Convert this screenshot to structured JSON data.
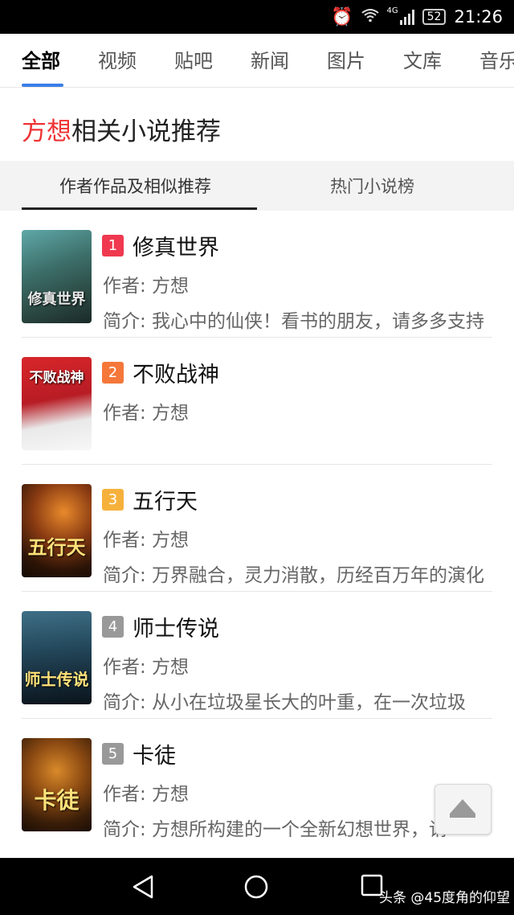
{
  "status_bar": {
    "signal_label": "4G",
    "battery": "52",
    "time": "21:26"
  },
  "nav_tabs": [
    {
      "label": "全部"
    },
    {
      "label": "视频"
    },
    {
      "label": "贴吧"
    },
    {
      "label": "新闻"
    },
    {
      "label": "图片"
    },
    {
      "label": "文库"
    },
    {
      "label": "音乐"
    }
  ],
  "section": {
    "highlight": "方想",
    "title_rest": "相关小说推荐"
  },
  "sub_tabs": [
    {
      "label": "作者作品及相似推荐"
    },
    {
      "label": "热门小说榜"
    }
  ],
  "books": [
    {
      "rank": "1",
      "title": "修真世界",
      "author": "作者: 方想",
      "desc": "简介: 我心中的仙侠！看书的朋友，请多多支持",
      "cover_text": "修真世界",
      "rank_color": "#f0394f"
    },
    {
      "rank": "2",
      "title": "不败战神",
      "author": "作者: 方想",
      "desc": "",
      "cover_text": "不败战神",
      "rank_color": "#f5773a"
    },
    {
      "rank": "3",
      "title": "五行天",
      "author": "作者: 方想",
      "desc": "简介: 万界融合，灵力消散，历经百万年的演化",
      "cover_text": "五行天",
      "rank_color": "#f6b13c"
    },
    {
      "rank": "4",
      "title": "师士传说",
      "author": "作者: 方想",
      "desc": "简介: 从小在垃圾星长大的叶重，在一次垃圾",
      "cover_text": "师士传说",
      "rank_color": "#999999"
    },
    {
      "rank": "5",
      "title": "卡徒",
      "author": "作者: 方想",
      "desc": "简介: 方想所构建的一个全新幻想世界，请",
      "cover_text": "卡徒",
      "rank_color": "#999999"
    }
  ],
  "watermark": "头条 @45度角的仰望"
}
